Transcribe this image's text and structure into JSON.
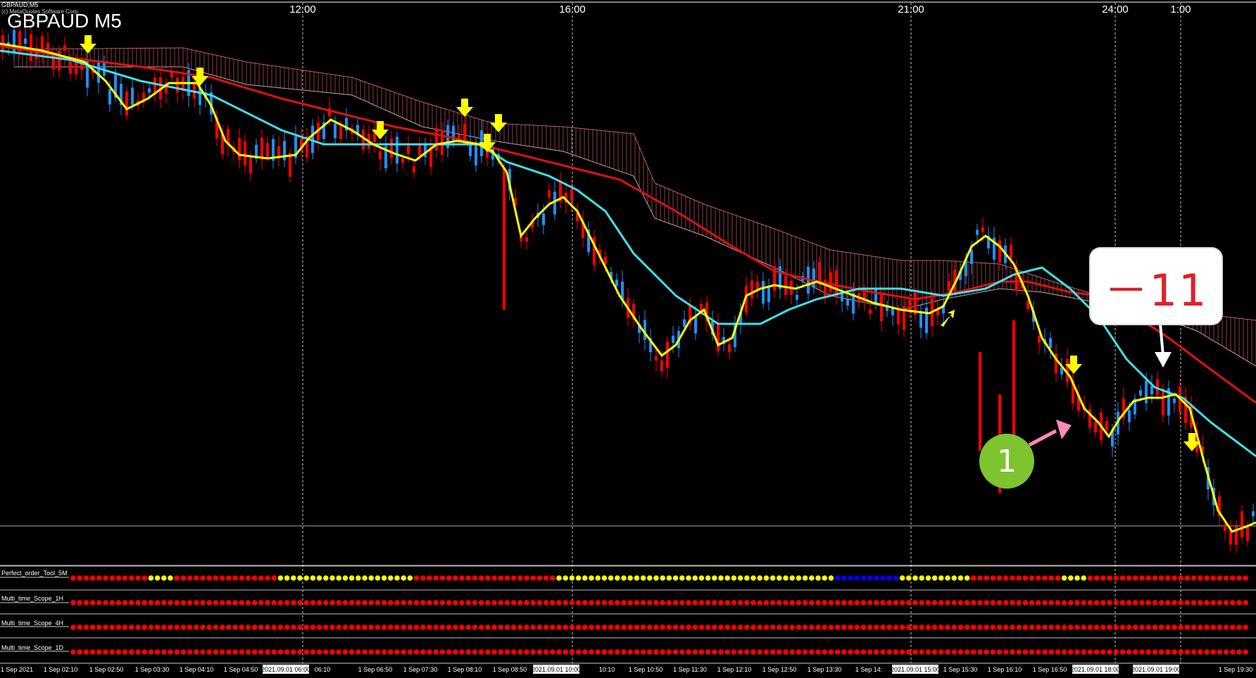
{
  "window": {
    "symbol_tab": "GBPAUD,M5",
    "subtitle": "(c) MetaQuotes Software Corp.",
    "chart_title": "GBPAUD M5"
  },
  "top_time_labels": [
    "12:00",
    "16:00",
    "21:00",
    "24:00",
    "1:00"
  ],
  "bottom_time_labels": [
    "1 Sep 2021",
    "1 Sep 02:10",
    "1 Sep 02:50",
    "1 Sep 03:30",
    "1 Sep 04:10",
    "1 Sep 04:50",
    "2021.09.01 06:00",
    "06:10",
    "1 Sep 06:50",
    "1 Sep 07:30",
    "1 Sep 08:10",
    "1 Sep 08:50",
    "2021.09.01 10:00",
    "10:10",
    "1 Sep 10:50",
    "1 Sep 11:30",
    "1 Sep 12:10",
    "1 Sep 12:50",
    "1 Sep 13:30",
    "1 Sep 14:",
    "2021.09.01 15:00",
    "1 Sep 15:30",
    "1 Sep 16:10",
    "1 Sep 16:50",
    "2021.09.01 18:00",
    "18:",
    "2021.09.01 19:00",
    "1 Sep 19:30"
  ],
  "indicators": [
    {
      "label": "Perfect_order_Tool_5M"
    },
    {
      "label": "Multi_time_Scope_1H"
    },
    {
      "label": "Multi_time_Scope_4H"
    },
    {
      "label": "Multi_time_Scope_1D"
    }
  ],
  "annotations": {
    "callout_value": "－11",
    "circle_label": "1"
  },
  "colors": {
    "background": "#000000",
    "bull_candle": "#1e90ff",
    "bear_candle": "#ff0000",
    "ma_fast": "#ffff00",
    "ma_mid": "#40e0e8",
    "ma_slow": "#e01010",
    "cloud": "#b05050",
    "signal_arrow": "#ffff00",
    "dot_red": "#ff0000",
    "dot_yellow": "#ffff00",
    "dot_blue": "#0000ff",
    "pink_arrow": "#ff88bb",
    "callout_text": "#e0202a",
    "circle_badge": "#7dc42f"
  }
}
